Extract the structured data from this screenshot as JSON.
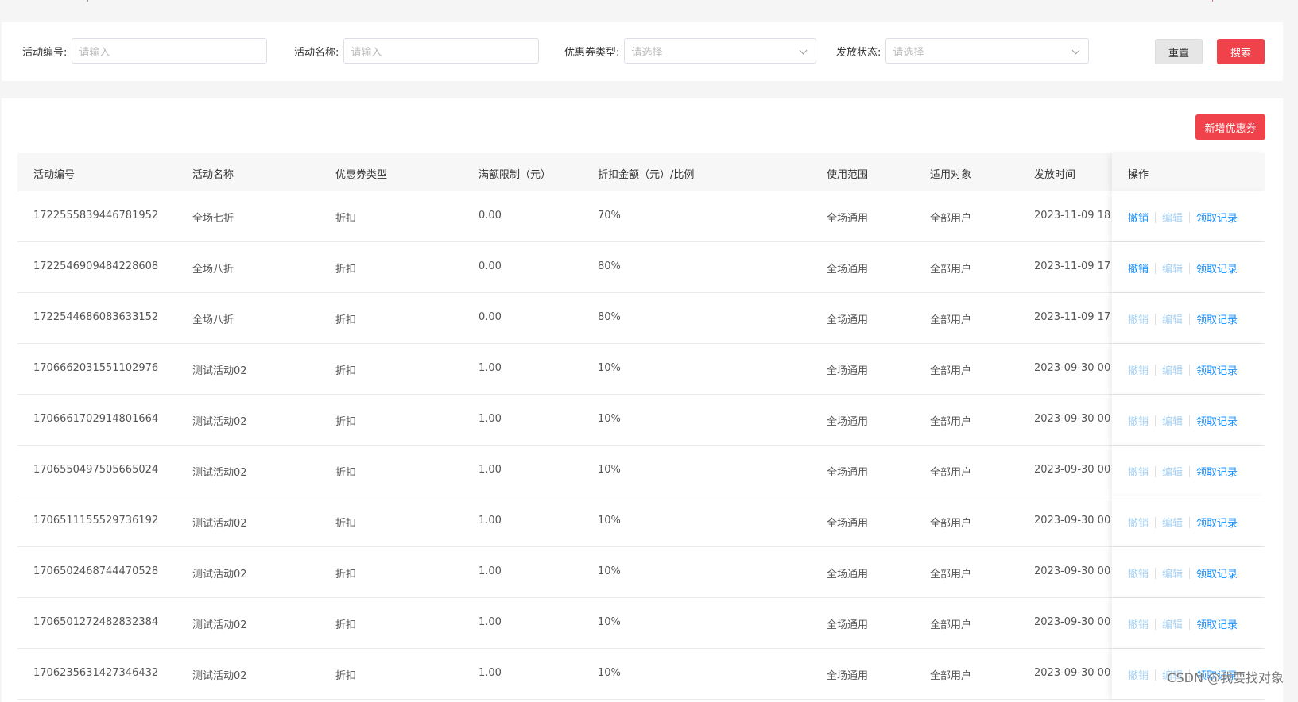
{
  "filters": {
    "activity_id_label": "活动编号:",
    "activity_id_placeholder": "请输入",
    "activity_name_label": "活动名称:",
    "activity_name_placeholder": "请输入",
    "coupon_type_label": "优惠券类型:",
    "coupon_type_placeholder": "请选择",
    "issue_status_label": "发放状态:",
    "issue_status_placeholder": "请选择",
    "reset_label": "重置",
    "search_label": "搜索"
  },
  "toolbar": {
    "add_label": "新增优惠券"
  },
  "table": {
    "headers": [
      "活动编号",
      "活动名称",
      "优惠券类型",
      "满额限制（元）",
      "折扣金额（元）/比例",
      "使用范围",
      "适用对象",
      "发放时间",
      "操作"
    ],
    "op_labels": {
      "revoke": "撤销",
      "edit": "编辑",
      "records": "领取记录"
    },
    "rows": [
      {
        "id": "1722555839446781952",
        "name": "全场七折",
        "type": "折扣",
        "limit": "0.00",
        "discount": "70%",
        "scope": "全场通用",
        "target": "全部用户",
        "time": "2023-11-09 18",
        "revoke_enabled": true,
        "edit_enabled": false
      },
      {
        "id": "1722546909484228608",
        "name": "全场八折",
        "type": "折扣",
        "limit": "0.00",
        "discount": "80%",
        "scope": "全场通用",
        "target": "全部用户",
        "time": "2023-11-09 17",
        "revoke_enabled": true,
        "edit_enabled": false
      },
      {
        "id": "1722544686083633152",
        "name": "全场八折",
        "type": "折扣",
        "limit": "0.00",
        "discount": "80%",
        "scope": "全场通用",
        "target": "全部用户",
        "time": "2023-11-09 17",
        "revoke_enabled": false,
        "edit_enabled": false
      },
      {
        "id": "1706662031551102976",
        "name": "测试活动02",
        "type": "折扣",
        "limit": "1.00",
        "discount": "10%",
        "scope": "全场通用",
        "target": "全部用户",
        "time": "2023-09-30 00",
        "revoke_enabled": false,
        "edit_enabled": false
      },
      {
        "id": "1706661702914801664",
        "name": "测试活动02",
        "type": "折扣",
        "limit": "1.00",
        "discount": "10%",
        "scope": "全场通用",
        "target": "全部用户",
        "time": "2023-09-30 00",
        "revoke_enabled": false,
        "edit_enabled": false
      },
      {
        "id": "1706550497505665024",
        "name": "测试活动02",
        "type": "折扣",
        "limit": "1.00",
        "discount": "10%",
        "scope": "全场通用",
        "target": "全部用户",
        "time": "2023-09-30 00",
        "revoke_enabled": false,
        "edit_enabled": false
      },
      {
        "id": "1706511155529736192",
        "name": "测试活动02",
        "type": "折扣",
        "limit": "1.00",
        "discount": "10%",
        "scope": "全场通用",
        "target": "全部用户",
        "time": "2023-09-30 00",
        "revoke_enabled": false,
        "edit_enabled": false
      },
      {
        "id": "1706502468744470528",
        "name": "测试活动02",
        "type": "折扣",
        "limit": "1.00",
        "discount": "10%",
        "scope": "全场通用",
        "target": "全部用户",
        "time": "2023-09-30 00",
        "revoke_enabled": false,
        "edit_enabled": false
      },
      {
        "id": "1706501272482832384",
        "name": "测试活动02",
        "type": "折扣",
        "limit": "1.00",
        "discount": "10%",
        "scope": "全场通用",
        "target": "全部用户",
        "time": "2023-09-30 00",
        "revoke_enabled": false,
        "edit_enabled": false
      },
      {
        "id": "1706235631427346432",
        "name": "测试活动02",
        "type": "折扣",
        "limit": "1.00",
        "discount": "10%",
        "scope": "全场通用",
        "target": "全部用户",
        "time": "2023-09-30 00",
        "revoke_enabled": false,
        "edit_enabled": false
      }
    ]
  },
  "watermark": "CSDN @我要找对象",
  "colors": {
    "primary": "#f0424a",
    "link": "#1890ff",
    "link_disabled": "#a8d3f5"
  }
}
